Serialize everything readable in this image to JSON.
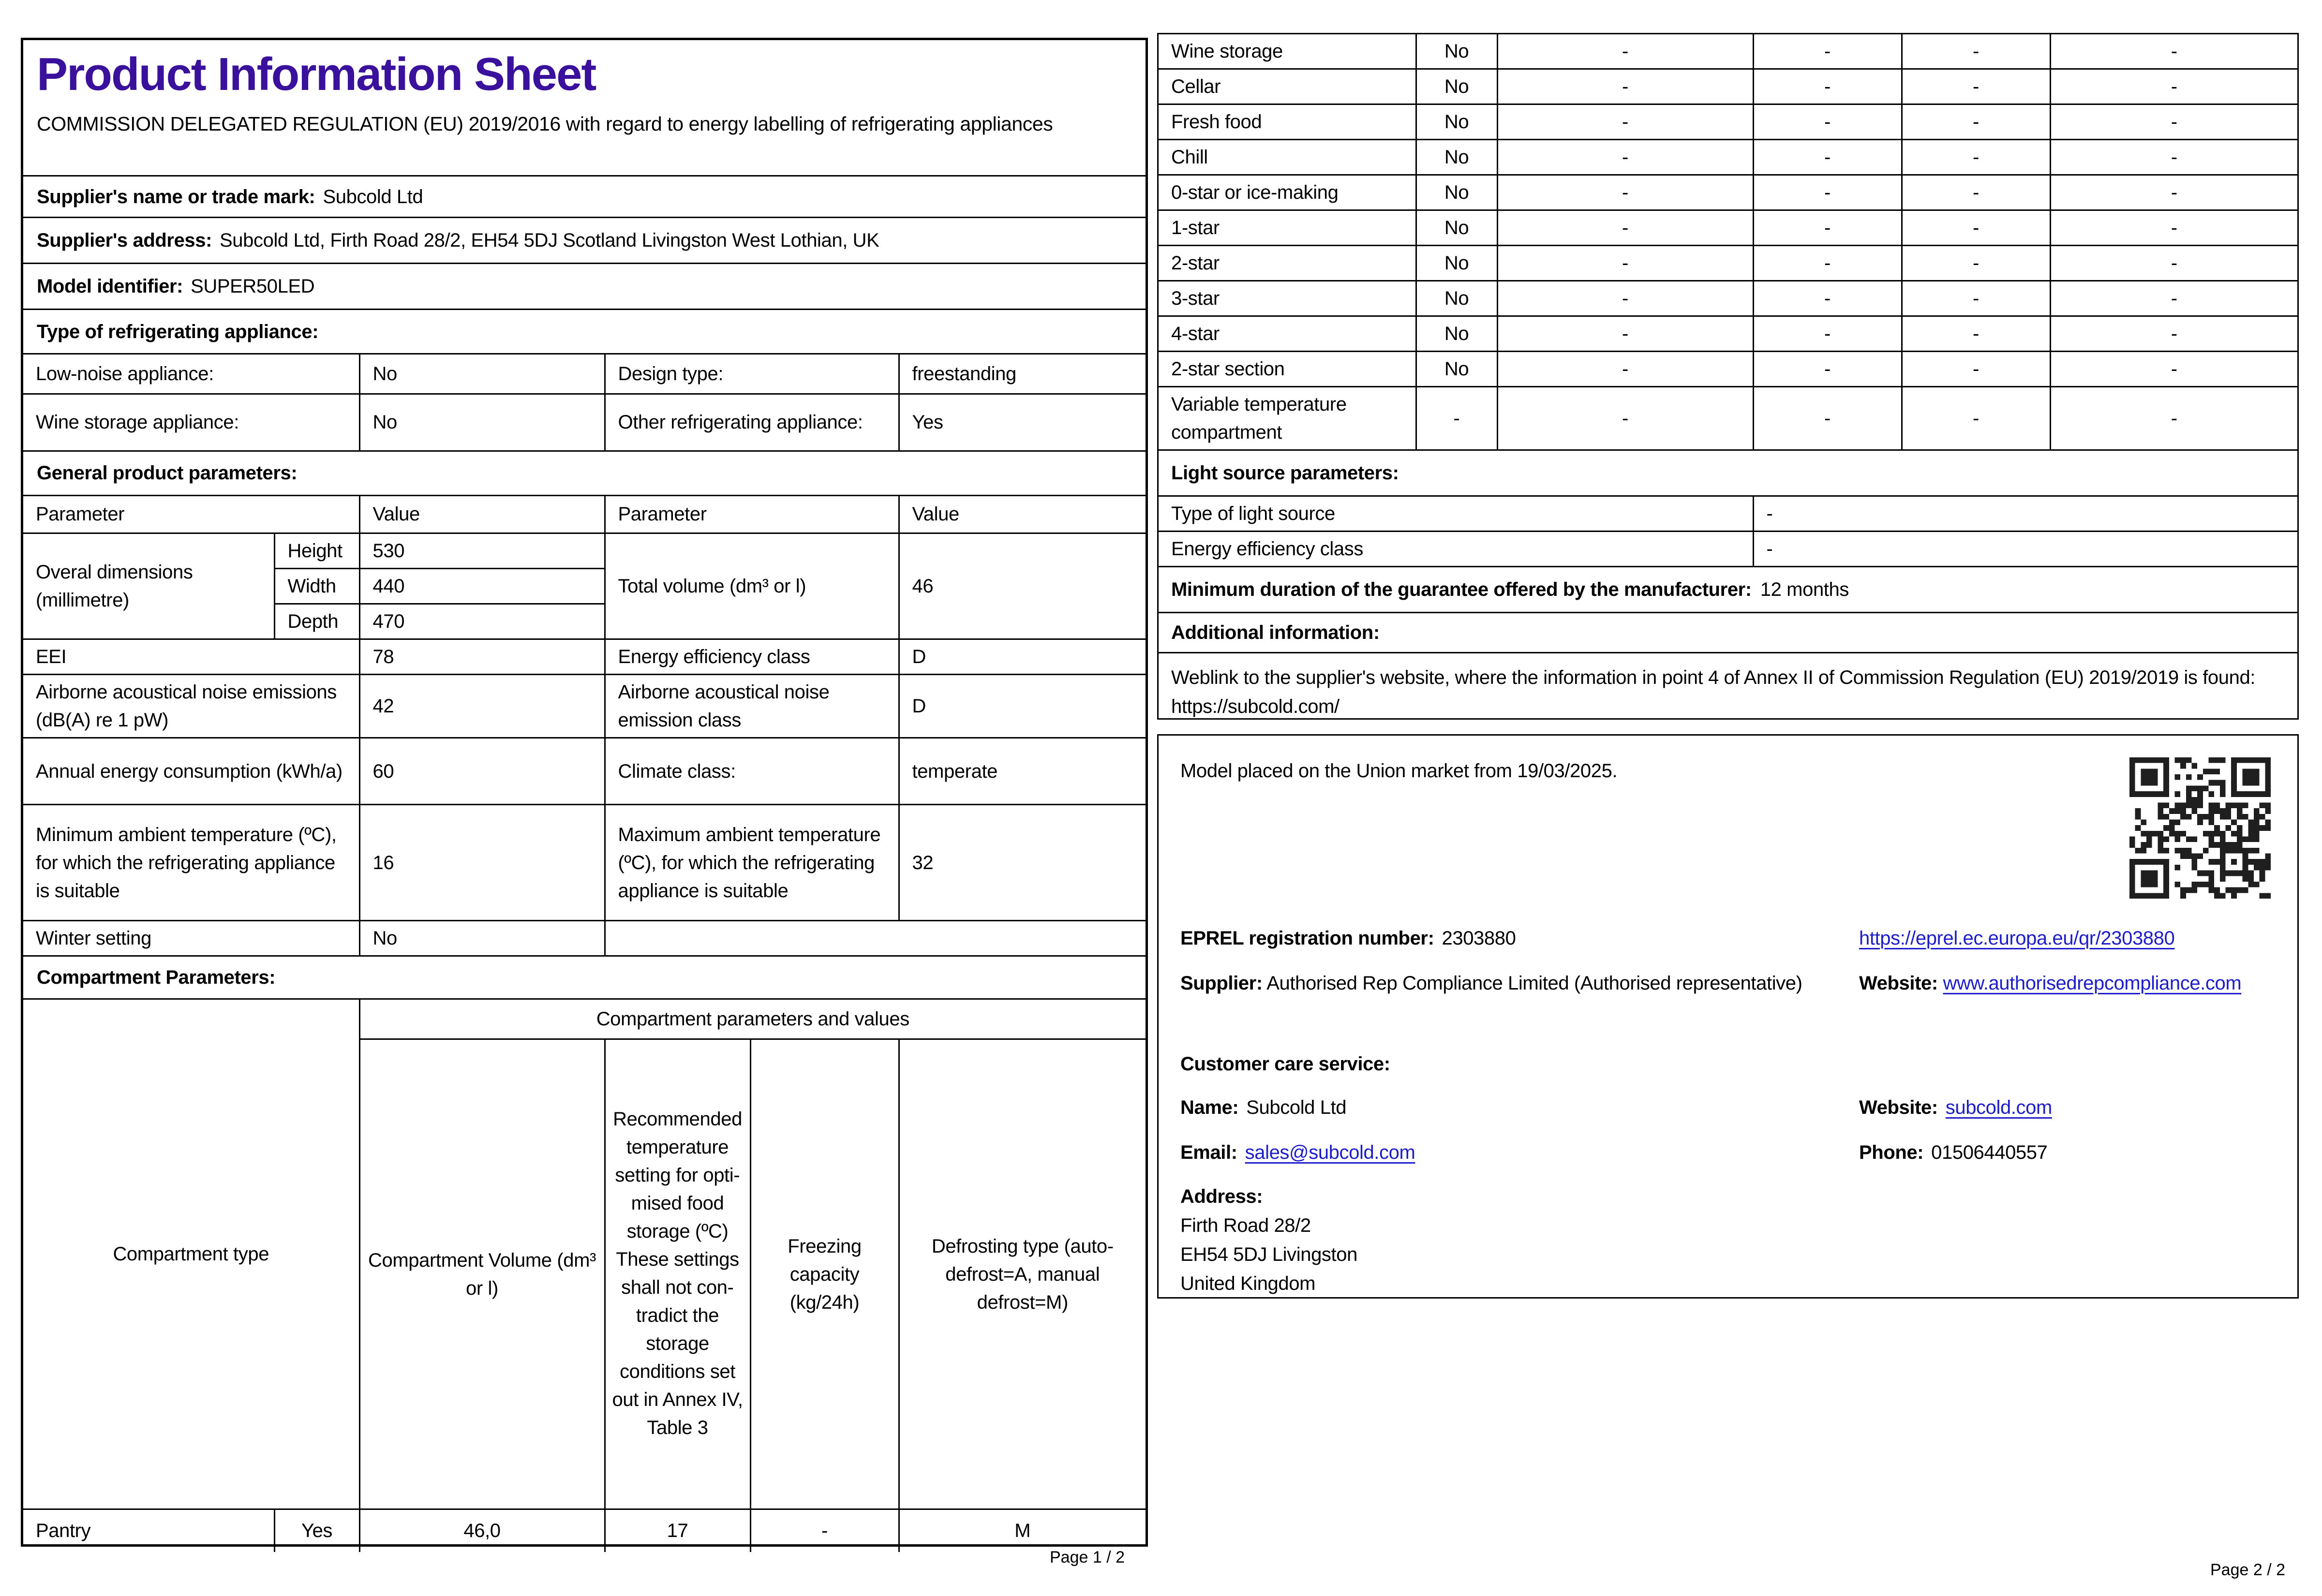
{
  "colors": {
    "title": "#3a119c",
    "link": "#1c1ccd",
    "border": "#000000"
  },
  "page1": {
    "title": "Product Information Sheet",
    "subtitle": "COMMISSION DELEGATED REGULATION (EU) 2019/2016 with regard to energy labelling of refrigerating appliances",
    "supplier_name_label": "Supplier's name or trade mark:",
    "supplier_name": "Subcold Ltd",
    "supplier_address_label": "Supplier's address:",
    "supplier_address": "Subcold Ltd, Firth Road 28/2, EH54 5DJ Scotland Livingston West Lothian, UK",
    "model_label": "Model identifier:",
    "model": "SUPER50LED",
    "type_section": "Type of refrigerating appliance:",
    "type_rows": [
      {
        "label": "Low-noise appliance:",
        "value": "No",
        "label2": "Design type:",
        "value2": "freestanding"
      },
      {
        "label": "Wine storage appliance:",
        "value": "No",
        "label2": "Other refrigerating appli­ance:",
        "value2": "Yes"
      }
    ],
    "general_section": "General product parameters:",
    "param_header": [
      "Parameter",
      "Value",
      "Parameter",
      "Value"
    ],
    "dimensions": {
      "label": "Overal dimensions (millimetre)",
      "height_label": "Height",
      "height": "530",
      "width_label": "Width",
      "width": "440",
      "depth_label": "Depth",
      "depth": "470",
      "volume_label": "Total volume (dm³ or l)",
      "volume": "46"
    },
    "param_rows": [
      [
        "EEI",
        "78",
        "Energy efficiency class",
        "D"
      ],
      [
        "Airborne acoustical noise emis­sions (dB(A) re 1 pW)",
        "42",
        "Airborne acoustical noise emission class",
        "D"
      ],
      [
        "Annual energy consumption (kWh/a)",
        "60",
        "Climate class:",
        "temperate"
      ],
      [
        "Minimum ambient tempera­ture (ºC), for which the refrig­erating appliance is suitable",
        "16",
        "Maximum ambient tem­perature (ºC), for which the refrigerating appliance is suitable",
        "32"
      ],
      [
        "Winter setting",
        "No"
      ]
    ],
    "compartment_section": "Compartment Parameters:",
    "compartment_table": {
      "type_header": "Compartment type",
      "group_header": "Compartment parameters and values",
      "volume_header": "Compartment Vol­ume (dm³ or l)",
      "temp_header_1": "Recom­mended tempera­ture setting for opti­mised food storage (ºC)",
      "temp_header_2": "These set­tings shall not con­tradict the storage conditions set out in Annex IV, Table 3",
      "freezing_header": "Freezing capacity (kg/24h)",
      "defrost_header": "Defrosting type (auto-defrost=A, manual defrost=M)",
      "row": {
        "type": "Pantry",
        "present": "Yes",
        "volume": "46,0",
        "temperature": "17",
        "freezing": "-",
        "defrost": "M"
      }
    },
    "page_label": "Page 1 / 2"
  },
  "page2": {
    "compartment_rows": [
      {
        "label": "Wine storage",
        "values": [
          "No",
          "-",
          "-",
          "-",
          "-"
        ]
      },
      {
        "label": "Cellar",
        "values": [
          "No",
          "-",
          "-",
          "-",
          "-"
        ]
      },
      {
        "label": "Fresh food",
        "values": [
          "No",
          "-",
          "-",
          "-",
          "-"
        ]
      },
      {
        "label": "Chill",
        "values": [
          "No",
          "-",
          "-",
          "-",
          "-"
        ]
      },
      {
        "label": "0-star or ice-making",
        "values": [
          "No",
          "-",
          "-",
          "-",
          "-"
        ]
      },
      {
        "label": "1-star",
        "values": [
          "No",
          "-",
          "-",
          "-",
          "-"
        ]
      },
      {
        "label": "2-star",
        "values": [
          "No",
          "-",
          "-",
          "-",
          "-"
        ]
      },
      {
        "label": "3-star",
        "values": [
          "No",
          "-",
          "-",
          "-",
          "-"
        ]
      },
      {
        "label": "4-star",
        "values": [
          "No",
          "-",
          "-",
          "-",
          "-"
        ]
      },
      {
        "label": "2-star section",
        "values": [
          "No",
          "-",
          "-",
          "-",
          "-"
        ]
      },
      {
        "label": "Variable temperature compartment",
        "values": [
          "-",
          "-",
          "-",
          "-",
          "-"
        ]
      }
    ],
    "light_section": "Light source parameters:",
    "light_rows": [
      {
        "label": "Type of light source",
        "value": "-"
      },
      {
        "label": "Energy efficiency class",
        "value": "-"
      }
    ],
    "guarantee_label": "Minimum duration of the guarantee offered by the manufacturer:",
    "guarantee_value": "12 months",
    "additional_section": "Additional information:",
    "weblink_text": "Weblink to the supplier's website, where the information in point 4 of Annex II of Commission Regulation (EU) 2019/2019 is found:",
    "weblink_url": "https://subcold.com/",
    "market_text": "Model placed on the Union market from 19/03/2025.",
    "eprel_label": "EPREL registration number:",
    "eprel_value": "2303880",
    "eprel_link": "https://eprel.ec.europa.eu/qr/2303880",
    "supplier_label": "Supplier:",
    "supplier_value": "Authorised Rep Compliance Limited (Authorised representative)",
    "website_label": "Website:",
    "website1": "www.authorisedrepcompliance.​com",
    "website2": "subcold.com",
    "care_section": "Customer care service:",
    "name_label": "Name:",
    "name_value": "Subcold Ltd",
    "email_label": "Email:",
    "email_value": "sales@subcold.com",
    "phone_label": "Phone:",
    "phone_value": "01506440557",
    "address_label": "Address:",
    "address_lines": [
      "Firth Road 28/2",
      "EH54 5DJ Livingston",
      "United Kingdom"
    ],
    "page_label": "Page 2 / 2"
  }
}
